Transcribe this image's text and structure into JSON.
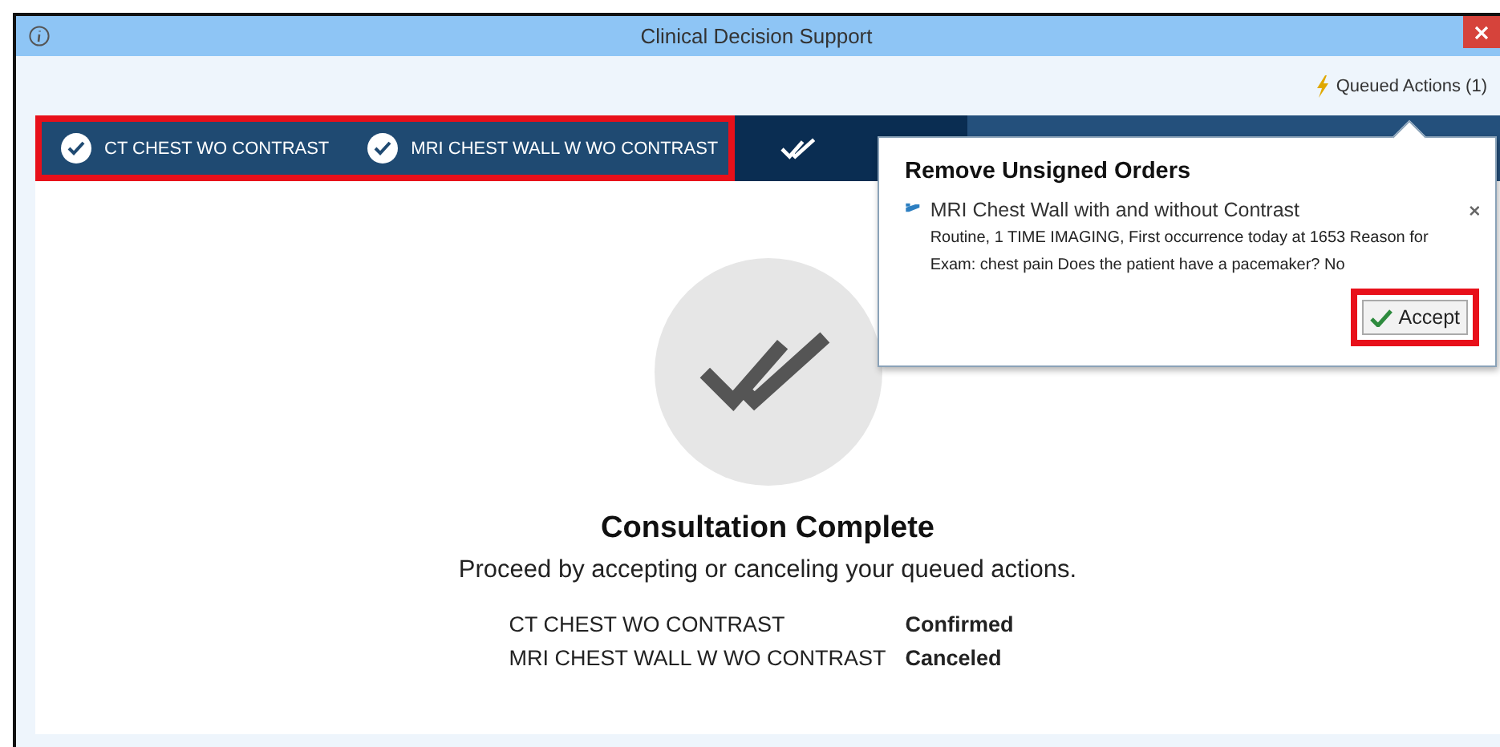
{
  "window": {
    "title": "Clinical Decision Support"
  },
  "queued_actions": {
    "label": "Queued Actions (1)"
  },
  "steps": {
    "highlighted": true,
    "items": [
      {
        "label": "CT CHEST WO CONTRAST",
        "done": true,
        "selected": false
      },
      {
        "label": "MRI CHEST WALL W WO CONTRAST",
        "done": true,
        "selected": false
      },
      {
        "selected": true
      }
    ]
  },
  "summary": {
    "title": "Consultation Complete",
    "message": "Proceed by accepting or canceling your queued actions.",
    "rows": [
      {
        "order": "CT CHEST WO CONTRAST",
        "status": "Confirmed"
      },
      {
        "order": "MRI CHEST WALL W WO CONTRAST",
        "status": "Canceled"
      }
    ]
  },
  "popover": {
    "title": "Remove Unsigned Orders",
    "order_name": "MRI Chest Wall with and without Contrast",
    "details": "Routine, 1 TIME IMAGING, First occurrence today at 1653 Reason for Exam: chest pain Does the patient have a pacemaker? No",
    "accept": {
      "label": "Accept",
      "highlighted": true
    }
  }
}
